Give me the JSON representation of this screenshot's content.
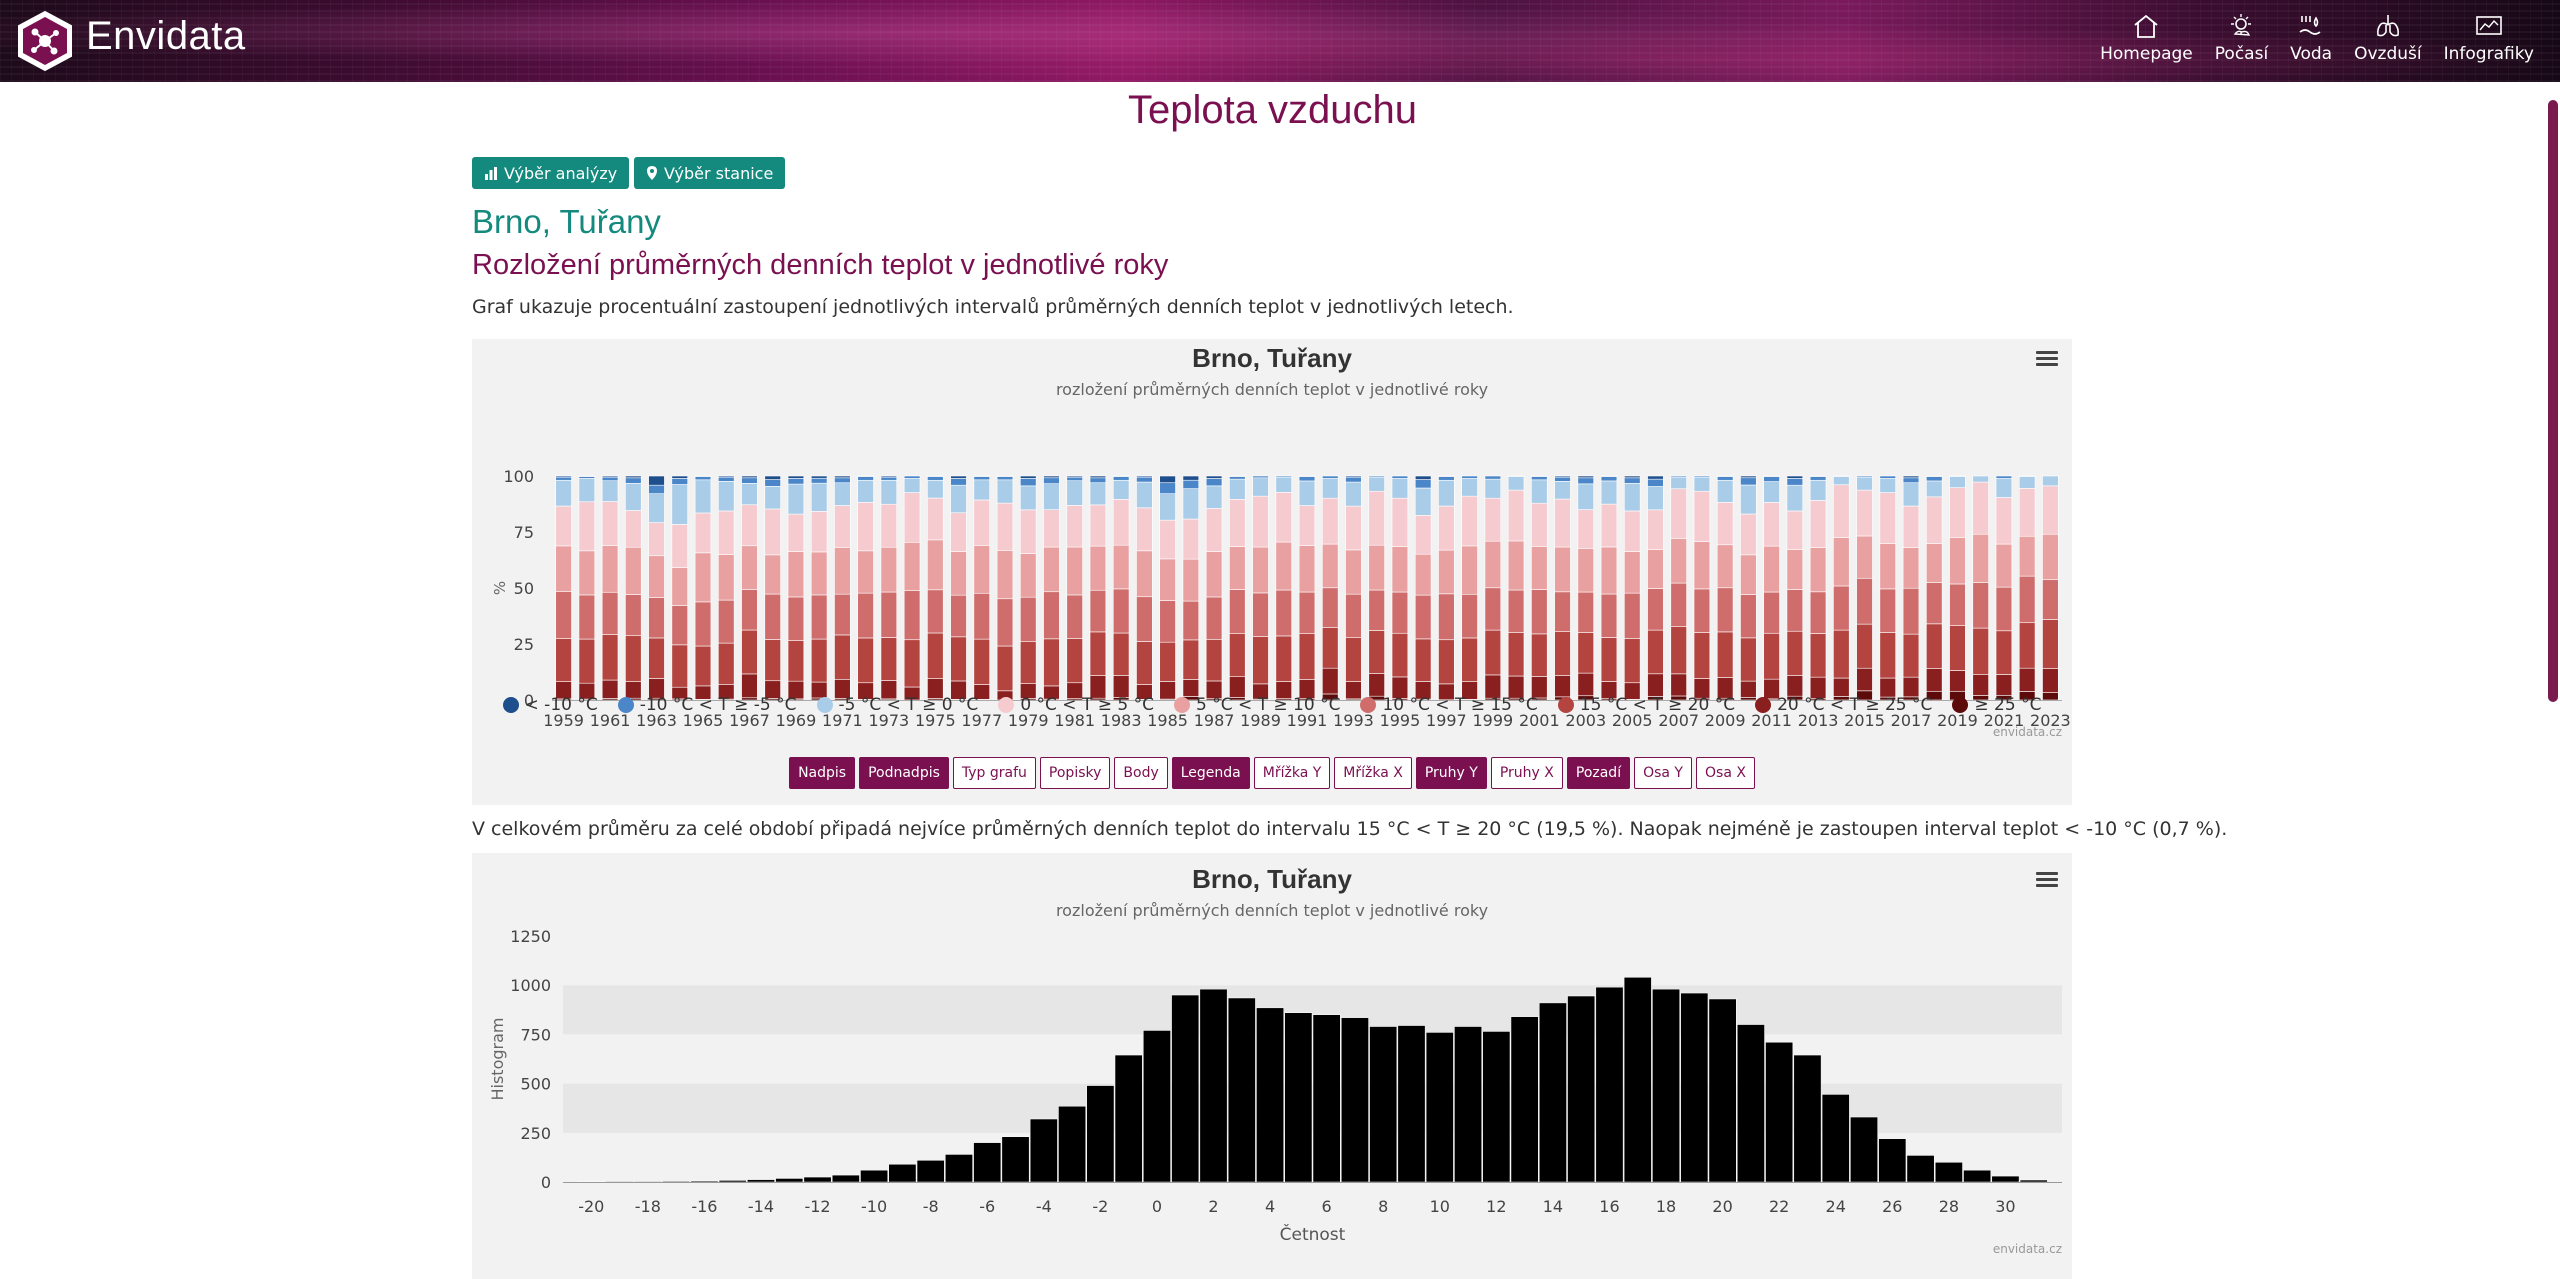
{
  "header": {
    "brand": "Envidata",
    "nav": [
      {
        "label": "Homepage",
        "icon": "home-icon"
      },
      {
        "label": "Počasí",
        "icon": "weather-icon"
      },
      {
        "label": "Voda",
        "icon": "water-icon"
      },
      {
        "label": "Ovzduší",
        "icon": "lungs-icon"
      },
      {
        "label": "Infografiky",
        "icon": "infographic-icon"
      }
    ]
  },
  "page": {
    "title": "Teplota vzduchu",
    "btn_analysis": "Výběr analýzy",
    "btn_station": "Výběr stanice",
    "station": "Brno, Tuřany",
    "subtitle": "Rozložení průměrných denních teplot v jednotlivé roky",
    "description": "Graf ukazuje procentuální zastoupení jednotlivých intervalů průměrných denních teplot v jednotlivých letech.",
    "summary": "V celkovém průměru za celé období připadá nejvíce průměrných denních teplot do intervalu 15 °C < T ≥ 20 °C (19,5 %). Naopak nejméně je zastoupen interval teplot < -10 °C (0,7 %).",
    "credit": "envidata.cz"
  },
  "toggles": [
    {
      "label": "Nadpis",
      "on": true
    },
    {
      "label": "Podnadpis",
      "on": true
    },
    {
      "label": "Typ grafu",
      "on": false
    },
    {
      "label": "Popisky",
      "on": false
    },
    {
      "label": "Body",
      "on": false
    },
    {
      "label": "Legenda",
      "on": true
    },
    {
      "label": "Mřížka Y",
      "on": false
    },
    {
      "label": "Mřížka X",
      "on": false
    },
    {
      "label": "Pruhy Y",
      "on": true
    },
    {
      "label": "Pruhy X",
      "on": false
    },
    {
      "label": "Pozadí",
      "on": true
    },
    {
      "label": "Osa Y",
      "on": false
    },
    {
      "label": "Osa X",
      "on": false
    }
  ],
  "colors": {
    "brand": "#7a1050",
    "accent": "#14897e"
  },
  "chart_data": [
    {
      "type": "bar",
      "stacked": true,
      "title": "Brno, Tuřany",
      "subtitle": "rozložení průměrných denních teplot v jednotlivé roky",
      "ylabel": "%",
      "xlabel": "",
      "ylim": [
        0,
        100
      ],
      "yticks": [
        0,
        25,
        50,
        75,
        100
      ],
      "legend_position": "bottom",
      "categories": [
        "1959",
        "1960",
        "1961",
        "1962",
        "1963",
        "1964",
        "1965",
        "1966",
        "1967",
        "1968",
        "1969",
        "1970",
        "1971",
        "1972",
        "1973",
        "1974",
        "1975",
        "1976",
        "1977",
        "1978",
        "1979",
        "1980",
        "1981",
        "1982",
        "1983",
        "1984",
        "1985",
        "1986",
        "1987",
        "1988",
        "1989",
        "1990",
        "1991",
        "1992",
        "1993",
        "1994",
        "1995",
        "1996",
        "1997",
        "1998",
        "1999",
        "2000",
        "2001",
        "2002",
        "2003",
        "2004",
        "2005",
        "2006",
        "2007",
        "2008",
        "2009",
        "2010",
        "2011",
        "2012",
        "2013",
        "2014",
        "2015",
        "2016",
        "2017",
        "2018",
        "2019",
        "2020",
        "2021",
        "2022",
        "2023"
      ],
      "xtick_labels": [
        "1959",
        "1961",
        "1963",
        "1965",
        "1967",
        "1969",
        "1971",
        "1973",
        "1975",
        "1977",
        "1979",
        "1981",
        "1983",
        "1985",
        "1987",
        "1989",
        "1991",
        "1993",
        "1995",
        "1997",
        "1999",
        "2001",
        "2003",
        "2005",
        "2007",
        "2009",
        "2011",
        "2013",
        "2015",
        "2017",
        "2019",
        "2021",
        "2023"
      ],
      "series": [
        {
          "name": "< -10 °C",
          "color": "#1f4e8c",
          "values": [
            0.5,
            0.3,
            0.5,
            0.8,
            4.1,
            1.1,
            0.3,
            0.5,
            0.8,
            1.6,
            1.1,
            1.0,
            0.8,
            0.3,
            0.5,
            0.0,
            0.3,
            1.1,
            0.3,
            0.3,
            1.1,
            0.8,
            0.5,
            0.8,
            0.3,
            0.5,
            3.0,
            1.9,
            1.1,
            0.3,
            0.0,
            0.0,
            0.3,
            0.0,
            0.5,
            0.0,
            0.0,
            1.6,
            0.3,
            0.0,
            0.0,
            0.0,
            0.3,
            0.5,
            0.8,
            0.3,
            0.8,
            1.4,
            0.0,
            0.0,
            0.3,
            0.8,
            0.3,
            1.1,
            0.3,
            0.0,
            0.0,
            0.0,
            0.8,
            0.3,
            0.0,
            0.0,
            0.0,
            0.0,
            0.0
          ]
        },
        {
          "name": "-10 °C < T ≥ -5 °C",
          "color": "#4a86c8",
          "values": [
            1.4,
            0.8,
            1.6,
            2.5,
            3.8,
            2.7,
            1.4,
            1.9,
            2.5,
            3.0,
            2.5,
            2.2,
            2.2,
            1.6,
            1.4,
            1.1,
            1.6,
            3.0,
            1.4,
            1.4,
            3.3,
            2.7,
            1.6,
            2.2,
            1.6,
            2.2,
            4.9,
            3.8,
            3.3,
            1.1,
            0.8,
            0.5,
            1.9,
            1.1,
            2.2,
            0.5,
            1.1,
            3.8,
            1.6,
            1.1,
            1.4,
            0.3,
            1.4,
            1.9,
            2.7,
            1.9,
            2.5,
            3.3,
            0.5,
            0.5,
            1.6,
            3.3,
            2.2,
            3.0,
            1.6,
            0.3,
            0.5,
            1.1,
            2.2,
            1.9,
            0.3,
            0.0,
            1.1,
            0.3,
            0.0
          ]
        },
        {
          "name": "-5 °C < T ≥ 0 °C",
          "color": "#a9cce9",
          "values": [
            11.5,
            10.4,
            9.3,
            12.1,
            12.9,
            17.8,
            14.8,
            13.2,
            9.6,
            10.1,
            13.4,
            12.6,
            10.1,
            9.9,
            10.7,
            6.3,
            7.9,
            12.3,
            9.0,
            10.4,
            10.7,
            11.8,
            11.0,
            9.9,
            8.5,
            11.5,
            11.8,
            13.7,
            10.1,
            9.0,
            8.2,
            6.8,
            11.0,
            8.8,
            10.7,
            6.3,
            8.8,
            12.3,
            11.5,
            7.9,
            8.5,
            6.0,
            10.4,
            7.9,
            11.5,
            10.4,
            12.3,
            10.4,
            5.2,
            6.3,
            9.9,
            13.2,
            9.3,
            11.5,
            9.0,
            3.6,
            5.8,
            6.3,
            10.4,
            7.1,
            4.9,
            2.7,
            8.5,
            5.2,
            4.4
          ]
        },
        {
          "name": "0 °C < T ≥ 5 °C",
          "color": "#f6cbd0",
          "values": [
            17.8,
            21.9,
            19.7,
            16.4,
            14.8,
            19.2,
            17.8,
            19.5,
            18.4,
            20.5,
            16.7,
            18.1,
            18.6,
            21.6,
            19.2,
            22.2,
            18.6,
            17.3,
            20.3,
            21.1,
            19.5,
            17.0,
            18.6,
            18.4,
            20.5,
            19.2,
            17.3,
            18.1,
            19.2,
            21.1,
            22.7,
            22.2,
            17.8,
            20.5,
            19.5,
            24.1,
            21.6,
            17.5,
            19.7,
            22.2,
            19.2,
            22.7,
            19.2,
            21.4,
            17.3,
            19.2,
            18.1,
            17.8,
            22.2,
            22.5,
            18.9,
            18.6,
            19.5,
            17.3,
            21.1,
            23.6,
            20.5,
            22.7,
            18.6,
            20.8,
            22.2,
            23.3,
            20.8,
            21.4,
            21.6
          ]
        },
        {
          "name": "5 °C < T ≥ 10 °C",
          "color": "#e8a0a0",
          "values": [
            20.3,
            19.7,
            20.8,
            21.1,
            18.6,
            17.0,
            21.9,
            20.3,
            19.7,
            17.5,
            20.3,
            19.2,
            20.8,
            18.9,
            20.0,
            21.6,
            22.2,
            19.5,
            21.4,
            21.6,
            19.5,
            20.3,
            21.4,
            19.7,
            19.5,
            20.5,
            18.6,
            18.9,
            20.3,
            19.2,
            20.5,
            21.4,
            20.8,
            19.5,
            19.7,
            20.0,
            20.3,
            18.4,
            19.5,
            21.6,
            20.8,
            21.9,
            19.2,
            20.0,
            19.5,
            21.1,
            18.6,
            17.3,
            20.0,
            21.1,
            19.2,
            18.1,
            20.5,
            17.8,
            19.7,
            21.6,
            18.9,
            20.3,
            18.1,
            17.5,
            20.8,
            21.6,
            19.2,
            17.8,
            20.3
          ]
        },
        {
          "name": "10 °C < T ≥ 15 °C",
          "color": "#cf6d6d",
          "values": [
            21.1,
            19.7,
            18.9,
            18.4,
            18.1,
            17.5,
            19.7,
            19.2,
            18.1,
            20.3,
            19.5,
            19.7,
            18.1,
            20.0,
            20.3,
            21.9,
            19.2,
            18.6,
            20.5,
            21.1,
            19.7,
            21.4,
            19.5,
            18.6,
            19.7,
            20.0,
            18.6,
            17.5,
            18.9,
            19.7,
            19.5,
            20.5,
            18.6,
            17.8,
            19.2,
            18.1,
            18.4,
            19.7,
            20.5,
            19.5,
            18.9,
            18.9,
            19.7,
            17.8,
            18.1,
            19.5,
            20.3,
            18.6,
            19.5,
            19.5,
            19.7,
            19.7,
            18.4,
            18.6,
            18.6,
            19.7,
            20.5,
            19.5,
            20.5,
            18.4,
            18.6,
            20.3,
            19.5,
            20.8,
            17.8
          ]
        },
        {
          "name": "15 °C < T ≥ 20 °C",
          "color": "#b4443f",
          "values": [
            19.2,
            19.7,
            20.3,
            20.5,
            18.1,
            18.9,
            17.8,
            18.4,
            19.7,
            18.4,
            18.1,
            19.2,
            19.7,
            20.0,
            19.2,
            21.1,
            20.3,
            19.7,
            20.3,
            20.0,
            18.9,
            21.4,
            19.7,
            19.5,
            18.9,
            19.2,
            17.5,
            17.8,
            18.6,
            19.2,
            21.1,
            20.3,
            20.5,
            18.1,
            19.7,
            19.2,
            19.5,
            19.2,
            19.7,
            19.5,
            20.0,
            19.5,
            18.9,
            19.5,
            18.1,
            19.7,
            19.7,
            19.5,
            21.1,
            20.5,
            20.3,
            19.7,
            20.5,
            19.7,
            19.5,
            21.4,
            19.7,
            20.3,
            19.2,
            20.0,
            20.0,
            20.8,
            19.5,
            20.3,
            21.9
          ]
        },
        {
          "name": "20 °C < T ≥ 25 °C",
          "color": "#8a1f1f",
          "values": [
            7.7,
            7.1,
            8.2,
            7.4,
            8.8,
            5.2,
            6.0,
            6.6,
            10.7,
            7.9,
            7.9,
            7.1,
            8.5,
            7.4,
            8.2,
            5.8,
            8.8,
            8.2,
            6.6,
            4.1,
            6.6,
            6.0,
            7.1,
            10.1,
            9.9,
            6.6,
            7.9,
            7.7,
            7.9,
            9.3,
            6.8,
            7.7,
            8.5,
            11.5,
            7.7,
            10.1,
            9.6,
            7.9,
            7.1,
            7.9,
            10.4,
            9.9,
            9.6,
            9.6,
            10.1,
            7.7,
            7.4,
            10.1,
            9.9,
            8.8,
            9.3,
            7.4,
            8.8,
            9.3,
            9.6,
            8.2,
            10.1,
            8.5,
            8.8,
            10.1,
            9.3,
            9.3,
            9.3,
            10.4,
            10.7
          ]
        },
        {
          "name": "≥ 25 °C",
          "color": "#5c0a0a",
          "values": [
            0.5,
            0.4,
            0.7,
            0.8,
            0.8,
            0.5,
            0.3,
            0.4,
            1.0,
            0.7,
            0.5,
            0.9,
            0.7,
            0.3,
            0.5,
            0.0,
            0.7,
            0.3,
            0.3,
            0.0,
            0.7,
            0.4,
            0.6,
            0.8,
            1.1,
            0.3,
            0.4,
            1.6,
            0.6,
            1.1,
            0.4,
            0.6,
            0.6,
            2.7,
            0.5,
            1.7,
            0.7,
            0.4,
            0.1,
            0.3,
            0.8,
            0.8,
            0.9,
            1.4,
            1.9,
            0.6,
            0.3,
            1.6,
            1.8,
            0.8,
            0.8,
            1.2,
            0.5,
            1.7,
            0.6,
            1.6,
            4.1,
            1.3,
            1.4,
            3.9,
            3.9,
            2.0,
            2.1,
            3.8,
            3.3
          ]
        }
      ]
    },
    {
      "type": "bar",
      "title": "Brno, Tuřany",
      "subtitle": "rozložení průměrných denních teplot v jednotlivé roky",
      "ylabel": "Histogram",
      "xlabel": "Četnost",
      "ylim": [
        0,
        1250
      ],
      "yticks": [
        0,
        250,
        500,
        750,
        1000,
        1250
      ],
      "xlim": [
        -21,
        32
      ],
      "xticks": [
        -20,
        -18,
        -16,
        -14,
        -12,
        -10,
        -8,
        -6,
        -4,
        -2,
        0,
        2,
        4,
        6,
        8,
        10,
        12,
        14,
        16,
        18,
        20,
        22,
        24,
        26,
        28,
        30
      ],
      "x": [
        -20,
        -19,
        -18,
        -17,
        -16,
        -15,
        -14,
        -13,
        -12,
        -11,
        -10,
        -9,
        -8,
        -7,
        -6,
        -5,
        -4,
        -3,
        -2,
        -1,
        0,
        1,
        2,
        3,
        4,
        5,
        6,
        7,
        8,
        9,
        10,
        11,
        12,
        13,
        14,
        15,
        16,
        17,
        18,
        19,
        20,
        21,
        22,
        23,
        24,
        25,
        26,
        27,
        28,
        29,
        30,
        31
      ],
      "values": [
        2,
        3,
        3,
        4,
        5,
        8,
        12,
        18,
        25,
        35,
        60,
        90,
        110,
        140,
        200,
        230,
        320,
        385,
        490,
        645,
        770,
        950,
        980,
        935,
        885,
        860,
        850,
        835,
        790,
        795,
        760,
        790,
        765,
        840,
        910,
        945,
        990,
        1040,
        980,
        960,
        930,
        800,
        710,
        645,
        445,
        330,
        220,
        135,
        100,
        60,
        30,
        10
      ]
    }
  ]
}
